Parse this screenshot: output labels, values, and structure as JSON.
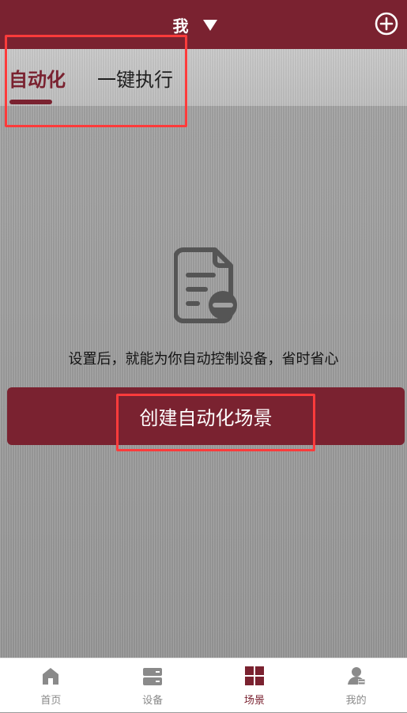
{
  "header": {
    "title": "我",
    "dropdown_icon": "caret-down-icon",
    "add_icon": "plus-circle-icon"
  },
  "tabs": [
    {
      "label": "自动化",
      "active": true
    },
    {
      "label": "一键执行",
      "active": false
    }
  ],
  "empty_state": {
    "icon": "document-minus-icon",
    "message": "设置后，就能为你自动控制设备，省时省心"
  },
  "primary_action": {
    "label": "创建自动化场景"
  },
  "bottom_nav": [
    {
      "label": "首页",
      "icon": "home-icon",
      "active": false
    },
    {
      "label": "设备",
      "icon": "device-icon",
      "active": false
    },
    {
      "label": "场景",
      "icon": "scene-grid-icon",
      "active": true
    },
    {
      "label": "我的",
      "icon": "user-icon",
      "active": false
    }
  ],
  "colors": {
    "primary": "#7a2230",
    "nav_inactive": "#8a8a8a",
    "highlight_outline": "#ff3b3b"
  }
}
